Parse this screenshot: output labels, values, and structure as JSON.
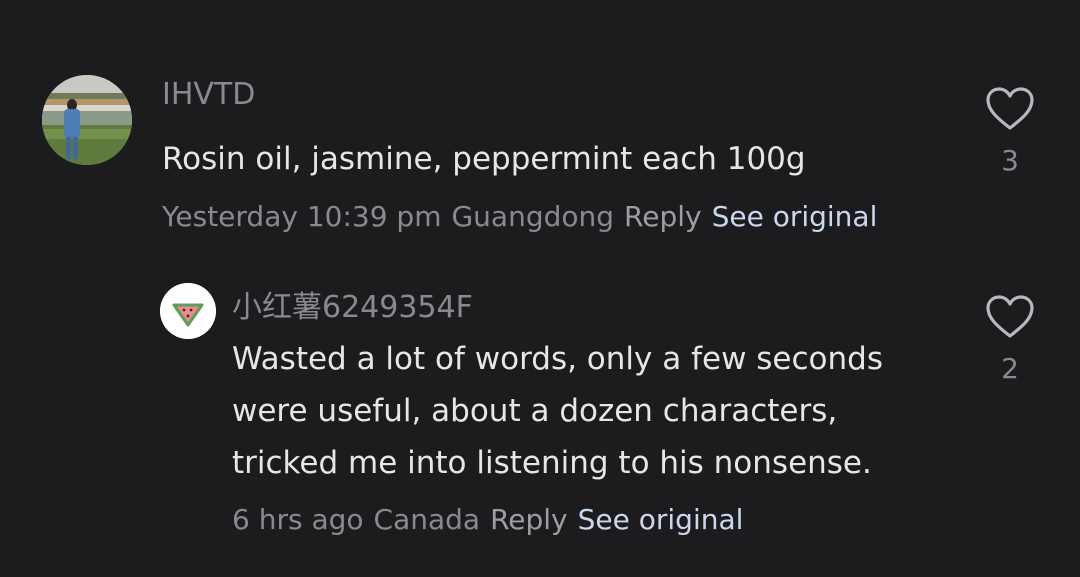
{
  "comments": [
    {
      "username": "IHVTD",
      "text": "Rosin oil, jasmine, peppermint each 100g",
      "time": "Yesterday 10:39 pm",
      "location": "Guangdong",
      "reply_label": "Reply",
      "see_original_label": "See original",
      "likes": "3",
      "avatar_icon": "person-photo-avatar"
    },
    {
      "username": "小红薯6249354F",
      "text": "Wasted a lot of words, only a few seconds were useful, about a dozen characters, tricked me into listening to his nonsense.",
      "time": "6 hrs ago",
      "location": "Canada",
      "reply_label": "Reply",
      "see_original_label": "See original",
      "likes": "2",
      "avatar_icon": "watermelon-avatar"
    }
  ],
  "colors": {
    "background": "#1c1c1e",
    "text_primary": "#e6e6e8",
    "text_secondary": "#8a8a8e",
    "link": "#c9d8ee"
  },
  "icons": {
    "like": "heart-outline-icon"
  }
}
